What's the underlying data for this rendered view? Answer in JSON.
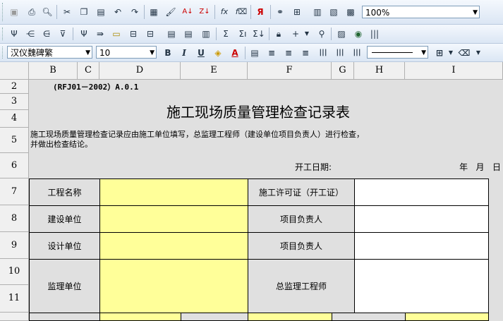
{
  "toolbar": {
    "zoom_value": "100%",
    "font_name": "汉仪魏碑繁",
    "font_size": "10",
    "sigma": "Σ",
    "sigma_insert": "Σı",
    "sigma_x": "Σ↓",
    "fx": "fx",
    "fx_insert": "f⌧",
    "bold": "B",
    "italic": "I",
    "underline": "U"
  },
  "columns": [
    "B",
    "C",
    "D",
    "E",
    "F",
    "G",
    "H",
    "I"
  ],
  "rows": [
    "2",
    "3",
    "4",
    "5",
    "6",
    "7",
    "8",
    "9",
    "10",
    "11"
  ],
  "form": {
    "code": "(RFJ01－2002）A.0.1",
    "title": "施工现场质量管理检查记录表",
    "instruction_line1": "施工现场质量管理检查记录应由施工单位填写，总监理工程师（建设单位项目负责人）进行检查，",
    "instruction_line2": "并做出检查结论。",
    "start_date_label": "开工日期:",
    "date_suffix": "年   月   日",
    "left_labels": [
      "工程名称",
      "建设单位",
      "设计单位",
      "监理单位"
    ],
    "right_labels": [
      "施工许可证（开工证）",
      "项目负责人",
      "项目负责人",
      "总监理工程师"
    ]
  }
}
